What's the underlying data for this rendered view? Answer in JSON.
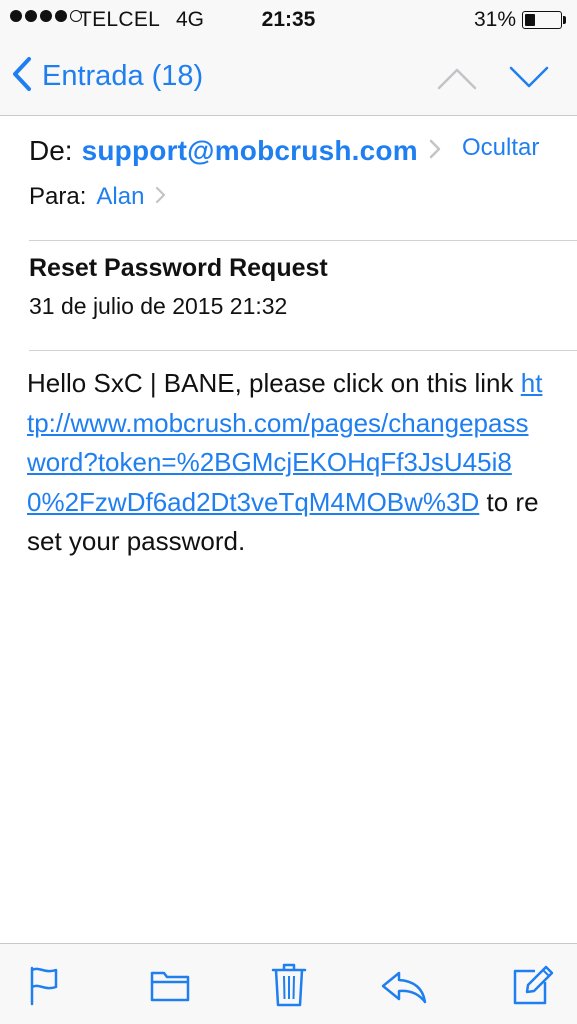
{
  "status_bar": {
    "carrier": "TELCEL",
    "network": "4G",
    "time": "21:35",
    "battery_percent_label": "31%",
    "battery_level": 0.31,
    "signal_strength": 4,
    "signal_max": 5
  },
  "nav": {
    "back_label": "Entrada (18)",
    "icons": {
      "back": "chevron-left-icon",
      "prev": "chevron-up-icon",
      "next": "chevron-down-icon"
    }
  },
  "header": {
    "from_label": "De:",
    "from_value": "support@mobcrush.com",
    "hide_label": "Ocultar",
    "to_label": "Para:",
    "to_value": "Alan"
  },
  "message": {
    "subject": "Reset Password Request",
    "date": "31 de julio de 2015 21:32",
    "body_intro": "Hello SxC | BANE, please click on this link ",
    "link": "http://www.mobcrush.com/pages/changepassword?token=%2BGMcjEKOHqFf3JsU45i80%2FzwDf6ad2Dt3veTqM4MOBw%3D",
    "body_outro": " to reset your password."
  },
  "toolbar": {
    "icons": [
      "flag-icon",
      "folder-icon",
      "trash-icon",
      "reply-icon",
      "compose-icon"
    ]
  },
  "colors": {
    "accent": "#1f7ff0",
    "bar_background": "#f8f8f8",
    "separator": "#d2d2d6"
  }
}
